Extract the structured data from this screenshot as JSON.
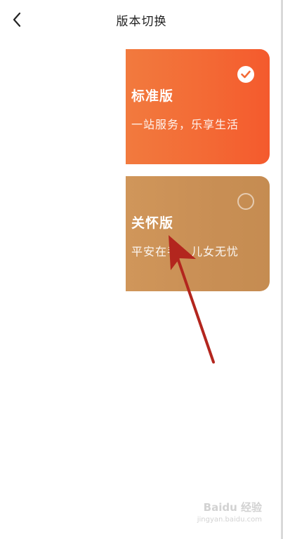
{
  "header": {
    "title": "版本切换",
    "back_icon": "chevron-left-icon"
  },
  "cards": [
    {
      "title": "标准版",
      "subtitle": "一站服务，乐享生活",
      "selected": true,
      "color_start": "#f27a3e",
      "color_end": "#f45a2d"
    },
    {
      "title": "关怀版",
      "subtitle": "平安在手，儿女无忧",
      "selected": false,
      "color_start": "#d0965a",
      "color_end": "#c58c51"
    }
  ],
  "annotation": {
    "arrow_color": "#b3261e"
  },
  "watermark": {
    "brand": "Baidu 经验",
    "url": "jingyan.baidu.com"
  }
}
